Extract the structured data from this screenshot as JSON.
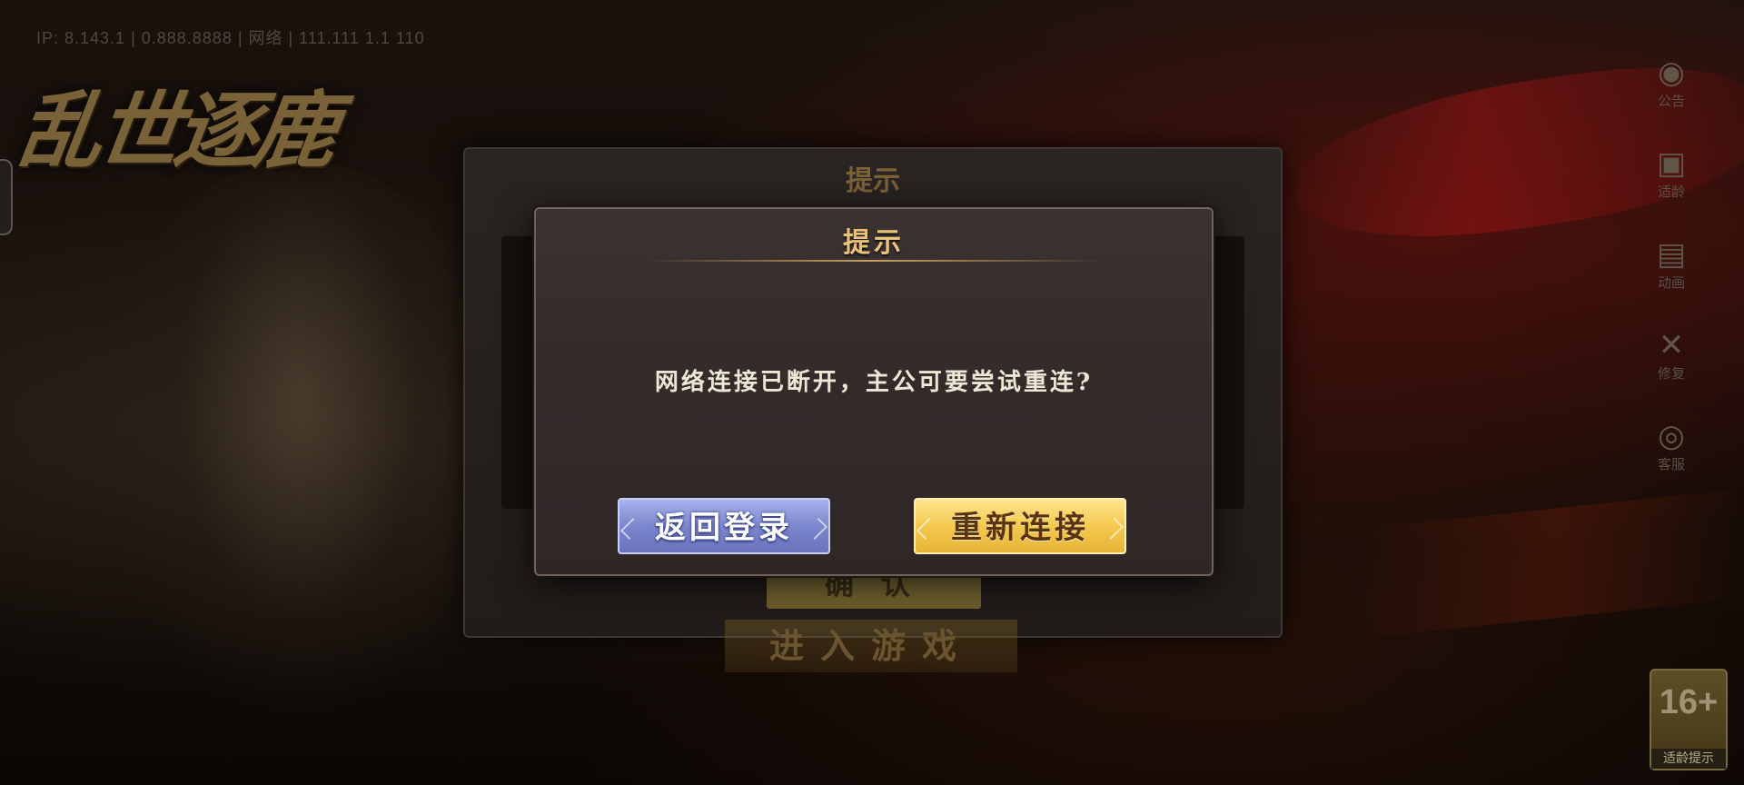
{
  "status_bar": {
    "text": "IP: 8.143.1 | 0.888.8888 | 网络 | 111.111 1.1 110"
  },
  "logo": {
    "text": "乱世逐鹿"
  },
  "side_menu": {
    "items": [
      {
        "icon": "announcement-icon",
        "glyph": "◉",
        "label": "公告"
      },
      {
        "icon": "age-rating-icon",
        "glyph": "▣",
        "label": "适龄"
      },
      {
        "icon": "video-icon",
        "glyph": "▤",
        "label": "动画"
      },
      {
        "icon": "repair-icon",
        "glyph": "✕",
        "label": "修复"
      },
      {
        "icon": "customer-service-icon",
        "glyph": "◎",
        "label": "客服"
      }
    ]
  },
  "background_dialog": {
    "title": "提示",
    "confirm_label": "确认"
  },
  "enter_game_label": "进入游戏",
  "dialog": {
    "title": "提示",
    "message": "网络连接已断开，主公可要尝试重连?",
    "back_button_label": "返回登录",
    "reconnect_button_label": "重新连接"
  },
  "age_rating": {
    "value": "16+",
    "label": "适龄提示"
  },
  "colors": {
    "title_gold": "#e8c27a",
    "back_button": "#7b87cc",
    "reconnect_button": "#f4c94f"
  }
}
